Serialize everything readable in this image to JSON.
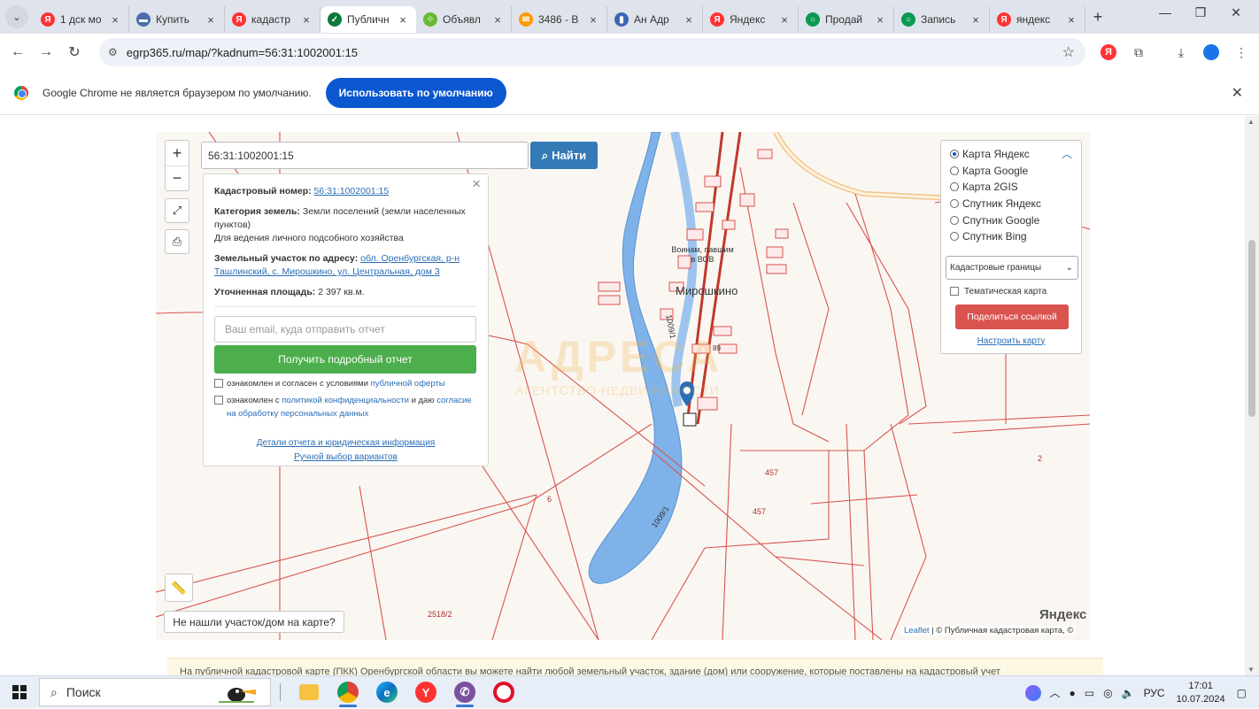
{
  "browser": {
    "tabs": [
      {
        "title": "1 дск мо",
        "favicon": "yandex",
        "color": "#f33"
      },
      {
        "title": "Купить",
        "favicon": "avito",
        "color": "#4a6fa5"
      },
      {
        "title": "кадастр",
        "favicon": "yandex",
        "color": "#f33"
      },
      {
        "title": "Публичн",
        "favicon": "check",
        "color": "#0a7a3d",
        "active": true
      },
      {
        "title": "Объявл",
        "favicon": "avito-dots",
        "color": "#6b3"
      },
      {
        "title": "3486 - В",
        "favicon": "mail",
        "color": "#f90"
      },
      {
        "title": "Ан Адр",
        "favicon": "building",
        "color": "#3a66b5"
      },
      {
        "title": "Яндекс",
        "favicon": "yandex",
        "color": "#f33"
      },
      {
        "title": "Продай",
        "favicon": "green-circle",
        "color": "#0a9a50"
      },
      {
        "title": "Запись",
        "favicon": "green-circle",
        "color": "#0a9a50"
      },
      {
        "title": "яндекс",
        "favicon": "yandex",
        "color": "#f33"
      }
    ],
    "url": "egrp365.ru/map/?kadnum=56:31:1002001:15",
    "infobar_message": "Google Chrome не является браузером по умолчанию.",
    "infobar_button": "Использовать по умолчанию"
  },
  "map": {
    "search_value": "56:31:1002001:15",
    "find_button": "Найти",
    "zoom_in": "+",
    "zoom_out": "−",
    "labels": {
      "village": "Мирошкино",
      "monument": "Воинам, павшим в ВОВ",
      "lot_457a": "457",
      "lot_457b": "457",
      "lot_2": "2",
      "lot_6": "6",
      "lot_2518": "2518/2",
      "lot_1009a": "1009/1",
      "lot_1009b": "1009/1",
      "lot_89": "89",
      "watermark_main": "АДРЕСА",
      "watermark_sub": "АГЕНТСТВО НЕДВИЖИМОСТИ"
    },
    "not_found": "Не нашли участок/дом на карте?",
    "attribution_leaflet": "Leaflet",
    "attribution_rest": "| © Публичная кадастровая карта, ©",
    "yandex_logo": "Яндекс"
  },
  "info": {
    "kadnum_label": "Кадастровый номер:",
    "kadnum_value": "56:31:1002001:15",
    "category_label": "Категория земель:",
    "category_value": "Земли поселений (земли населенных пунктов)",
    "usage": "Для ведения личного подсобного хозяйства",
    "address_label": "Земельный участок по адресу:",
    "address_value": "обл. Оренбургская, р-н Ташлинский, с. Мирошкино, ул. Центральная, дом 3",
    "area_label": "Уточненная площадь:",
    "area_value": "2 397 кв.м.",
    "email_placeholder": "Ваш email, куда отправить отчет",
    "report_button": "Получить подробный отчет",
    "check1_text": "ознакомлен и согласен с условиями",
    "check1_link": "публичной оферты",
    "check2_text": "ознакомлен с",
    "check2_link": "политикой конфиденциальности",
    "check2_mid": "и даю",
    "check2_link2": "согласие на обработку персональных данных",
    "details_link": "Детали отчета и юридическая информация",
    "manual_link": "Ручной выбор вариантов"
  },
  "layers": {
    "options": [
      "Карта Яндекс",
      "Карта Google",
      "Карта 2GIS",
      "Спутник Яндекс",
      "Спутник Google",
      "Спутник Bing"
    ],
    "selected": "Карта Яндекс",
    "overlay_select": "Кадастровые границы",
    "thematic": "Тематическая карта",
    "share_button": "Поделиться ссылкой",
    "configure": "Настроить карту"
  },
  "banner_text": "На публичной кадастровой карте (ПКК) Оренбургской области вы можете найти любой земельный участок, здание (дом) или сооружение, которые поставлены на кадастровый учет",
  "taskbar": {
    "search": "Поиск",
    "lang": "РУС",
    "time": "17:01",
    "date": "10.07.2024"
  }
}
